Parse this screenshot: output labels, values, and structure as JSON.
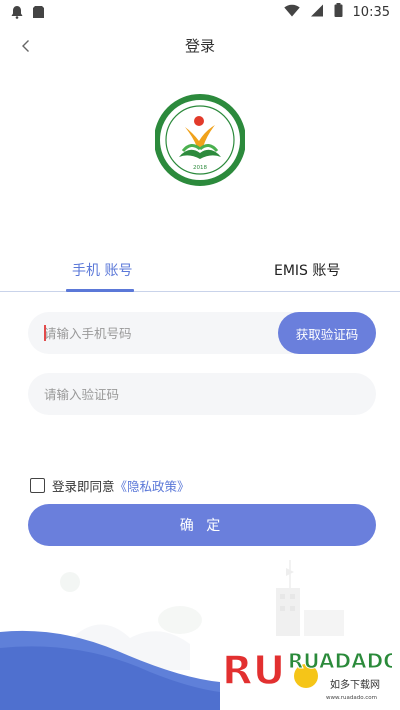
{
  "status_bar": {
    "time": "10:35",
    "left_icons": [
      "notification-icon",
      "storage-icon"
    ],
    "right_icons": [
      "wifi-icon"
    ]
  },
  "header": {
    "title": "登录",
    "back_icon": "chevron-left-icon"
  },
  "logo": {
    "year_text": "2018"
  },
  "tabs": [
    {
      "label": "手机 账号",
      "active": true
    },
    {
      "label": "EMIS 账号",
      "active": false
    }
  ],
  "form": {
    "phone_placeholder": "请输入手机号码",
    "phone_value": "",
    "get_code_label": "获取验证码",
    "code_placeholder": "请输入验证码",
    "code_value": ""
  },
  "agreement": {
    "checked": false,
    "text": "登录即同意",
    "link": "《隐私政策》"
  },
  "confirm_label": "确 定",
  "watermark": {
    "brand": "RUADADO",
    "sub": "如多下载网",
    "url": "www.ruadado.com"
  },
  "colors": {
    "accent": "#5b78d8",
    "button": "#6a7fdc",
    "field_bg": "#f5f6f8",
    "wave": "#5f80d9"
  }
}
